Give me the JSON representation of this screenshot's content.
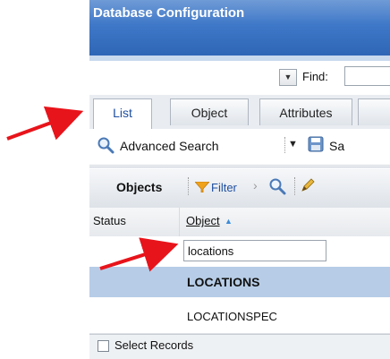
{
  "window": {
    "title": "Database Configuration"
  },
  "find": {
    "label": "Find:",
    "value": ""
  },
  "tabs": [
    {
      "label": "List",
      "active": true
    },
    {
      "label": "Object",
      "active": false
    },
    {
      "label": "Attributes",
      "active": false
    }
  ],
  "toolbar": {
    "advanced_search_label": "Advanced Search",
    "save_label": "Sa"
  },
  "objects_bar": {
    "title": "Objects",
    "filter_label": "Filter"
  },
  "table": {
    "columns": [
      "Status",
      "Object"
    ],
    "filter_value": "locations",
    "rows": [
      {
        "status": "",
        "object": "LOCATIONS",
        "selected": true
      },
      {
        "status": "",
        "object": "LOCATIONSPEC",
        "selected": false
      }
    ]
  },
  "footer": {
    "select_records_label": "Select Records"
  },
  "colors": {
    "title_bar": "#3f78c8",
    "selected_row": "#b7cde7",
    "annotation_arrow": "#e8141b",
    "link_blue": "#1f4fa0"
  }
}
